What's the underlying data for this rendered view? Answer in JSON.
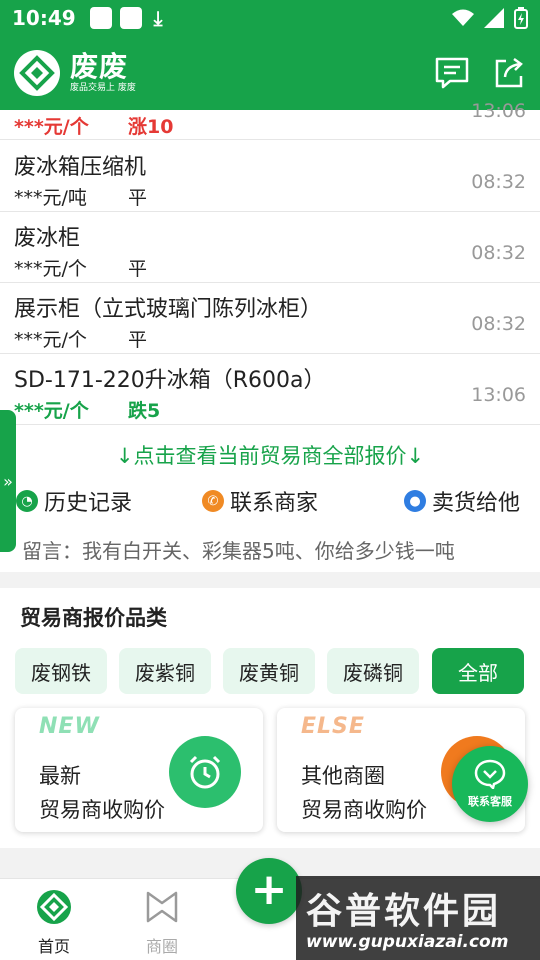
{
  "status_bar": {
    "time": "10:49"
  },
  "header": {
    "brand_name": "废废",
    "slogan": "废品交易上 废废"
  },
  "quotes": [
    {
      "title": "",
      "price": "***元/个",
      "trend": "涨10",
      "time": "13:06",
      "trend_color": "red"
    },
    {
      "title": "废冰箱压缩机",
      "price": "***元/吨",
      "trend": "平",
      "time": "08:32",
      "trend_color": "normal"
    },
    {
      "title": "废冰柜",
      "price": "***元/个",
      "trend": "平",
      "time": "08:32",
      "trend_color": "normal"
    },
    {
      "title": "展示柜（立式玻璃门陈列冰柜）",
      "price": "***元/个",
      "trend": "平",
      "time": "08:32",
      "trend_color": "normal"
    },
    {
      "title": "SD-171-220升冰箱（R600a）",
      "price": "***元/个",
      "trend": "跌5",
      "time": "13:06",
      "trend_color": "green"
    }
  ],
  "view_all": "↓点击查看当前贸易商全部报价↓",
  "actions": {
    "history": "历史记录",
    "contact": "联系商家",
    "sell": "卖货给他"
  },
  "message": "留言：我有白开关、彩集器5吨、你给多少钱一吨",
  "categories": {
    "title": "贸易商报价品类",
    "chips": [
      "废钢铁",
      "废紫铜",
      "废黄铜",
      "废磷铜",
      "全部"
    ]
  },
  "cards": [
    {
      "tag": "NEW",
      "line1": "最新",
      "line2": "贸易商收购价"
    },
    {
      "tag": "ELSE",
      "line1": "其他商圈",
      "line2": "贸易商收购价"
    }
  ],
  "kefu": "联系客服",
  "nav": {
    "home": "首页",
    "circle": "商圈"
  },
  "watermark": {
    "big": "谷普软件园",
    "url": "www.gupuxiazai.com"
  },
  "colors": {
    "brand_green": "#17a34a",
    "up_red": "#e53935",
    "new_tag": "#8fe0b5",
    "else_tag": "#f5b88c",
    "contact_orange": "#f08a24",
    "sell_blue": "#2f7de1"
  }
}
